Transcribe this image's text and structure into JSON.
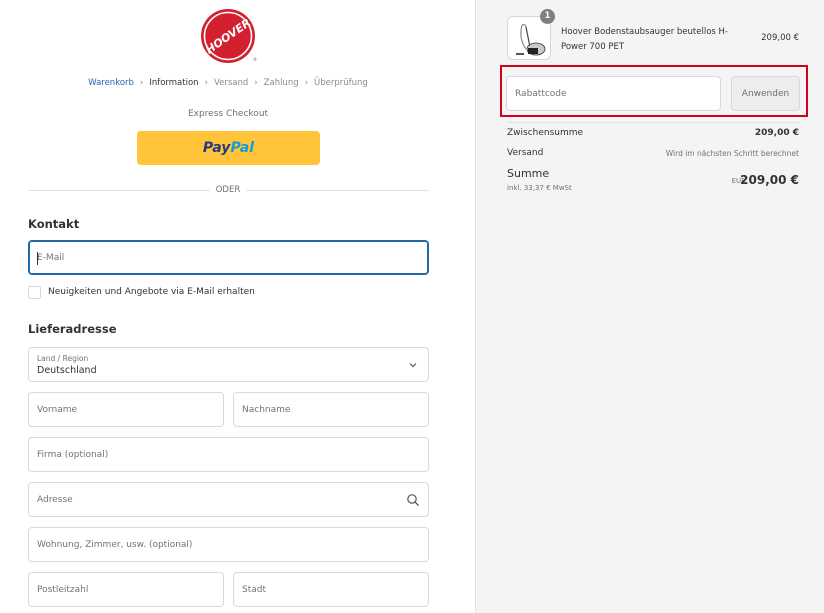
{
  "brand": {
    "logo_text": "HOOVER",
    "logo_red": "#d2202f"
  },
  "breadcrumb": [
    {
      "label": "Warenkorb",
      "state": "link"
    },
    {
      "label": "Information",
      "state": "current"
    },
    {
      "label": "Versand",
      "state": "upcoming"
    },
    {
      "label": "Zahlung",
      "state": "upcoming"
    },
    {
      "label": "Überprüfung",
      "state": "upcoming"
    }
  ],
  "express": {
    "label": "Express Checkout",
    "paypal_pay": "Pay",
    "paypal_pal": "Pal",
    "divider_text": "ODER"
  },
  "contact": {
    "title": "Kontakt",
    "email_placeholder": "E-Mail",
    "newsletter_label": "Neuigkeiten und Angebote via E-Mail erhalten"
  },
  "shipping": {
    "title": "Lieferadresse",
    "country_label": "Land / Region",
    "country_value": "Deutschland",
    "first_name_placeholder": "Vorname",
    "last_name_placeholder": "Nachname",
    "company_placeholder": "Firma (optional)",
    "address_placeholder": "Adresse",
    "apartment_placeholder": "Wohnung, Zimmer, usw. (optional)",
    "postal_placeholder": "Postleitzahl",
    "city_placeholder": "Stadt"
  },
  "summary": {
    "product": {
      "quantity": "1",
      "name": "Hoover Bodenstaubsauger beutellos H-Power 700 PET",
      "price": "209,00 €"
    },
    "coupon_placeholder": "Rabattcode",
    "apply_label": "Anwenden",
    "subtotal_label": "Zwischensumme",
    "subtotal_value": "209,00 €",
    "shipping_label": "Versand",
    "shipping_value": "Wird im nächsten Schritt berechnet",
    "total_label": "Summe",
    "tax_note": "inkl. 33,37 € MwSt",
    "currency": "EUR",
    "total_value": "209,00 €"
  },
  "colors": {
    "accent": "#2469b3",
    "highlight": "#d0021b",
    "paypal_yellow": "#ffc439"
  }
}
